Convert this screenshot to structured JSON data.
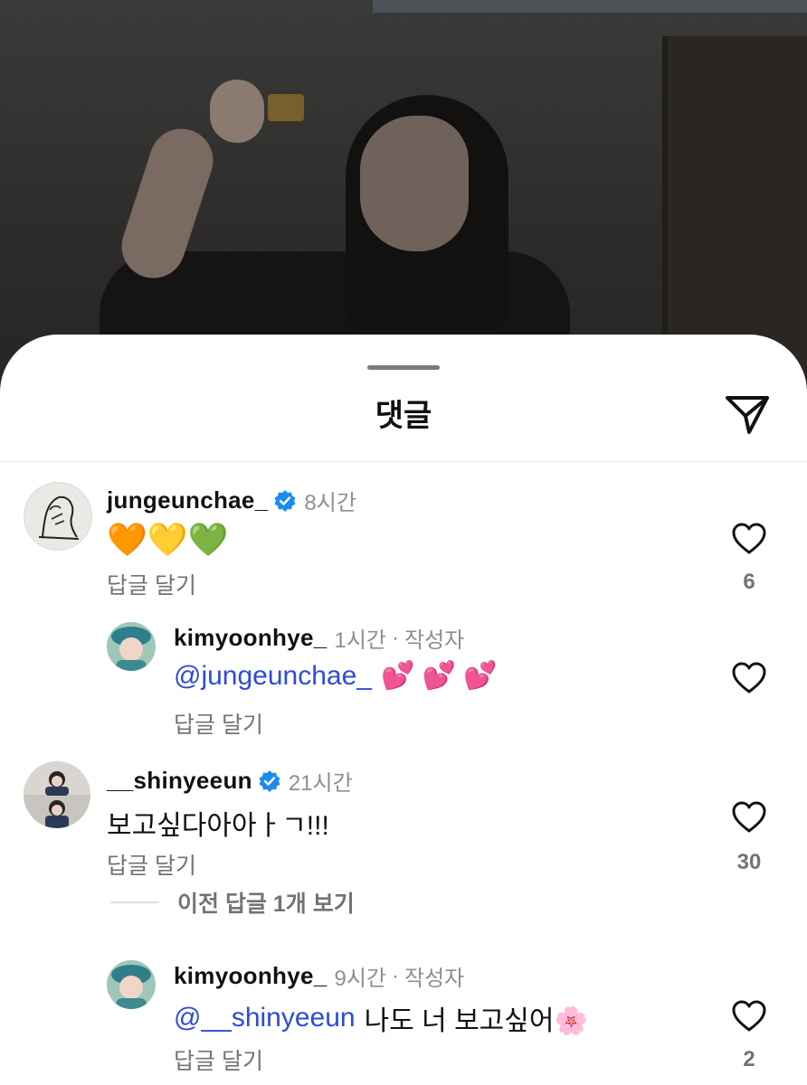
{
  "sheet": {
    "title": "댓글"
  },
  "comments": [
    {
      "username": "jungeunchae_",
      "verified": true,
      "time": "8시간",
      "text": "🧡💛💚",
      "reply_label": "답글 달기",
      "likes": "6"
    },
    {
      "username": "kimyoonhye_",
      "time": "1시간",
      "separator": "·",
      "author_label": "작성자",
      "mention": "@jungeunchae_",
      "text": "💕 💕 💕",
      "reply_label": "답글 달기"
    },
    {
      "username": "__shinyeeun",
      "verified": true,
      "time": "21시간",
      "text": "보고싶다아아ㅏㄱ!!!",
      "reply_label": "답글 달기",
      "likes": "30"
    },
    {
      "username": "kimyoonhye_",
      "time": "9시간",
      "separator": "·",
      "author_label": "작성자",
      "mention": "@__shinyeeun",
      "text": "나도 너 보고싶어🌸",
      "reply_label": "답글 달기",
      "likes": "2"
    }
  ],
  "view_previous": "이전 답글 1개 보기",
  "colors": {
    "mention": "#2f4bd8",
    "verified": "#1a8cf0",
    "muted": "#8e8e8e"
  },
  "icons": [
    "send-icon",
    "heart-icon",
    "verified-badge-icon"
  ]
}
